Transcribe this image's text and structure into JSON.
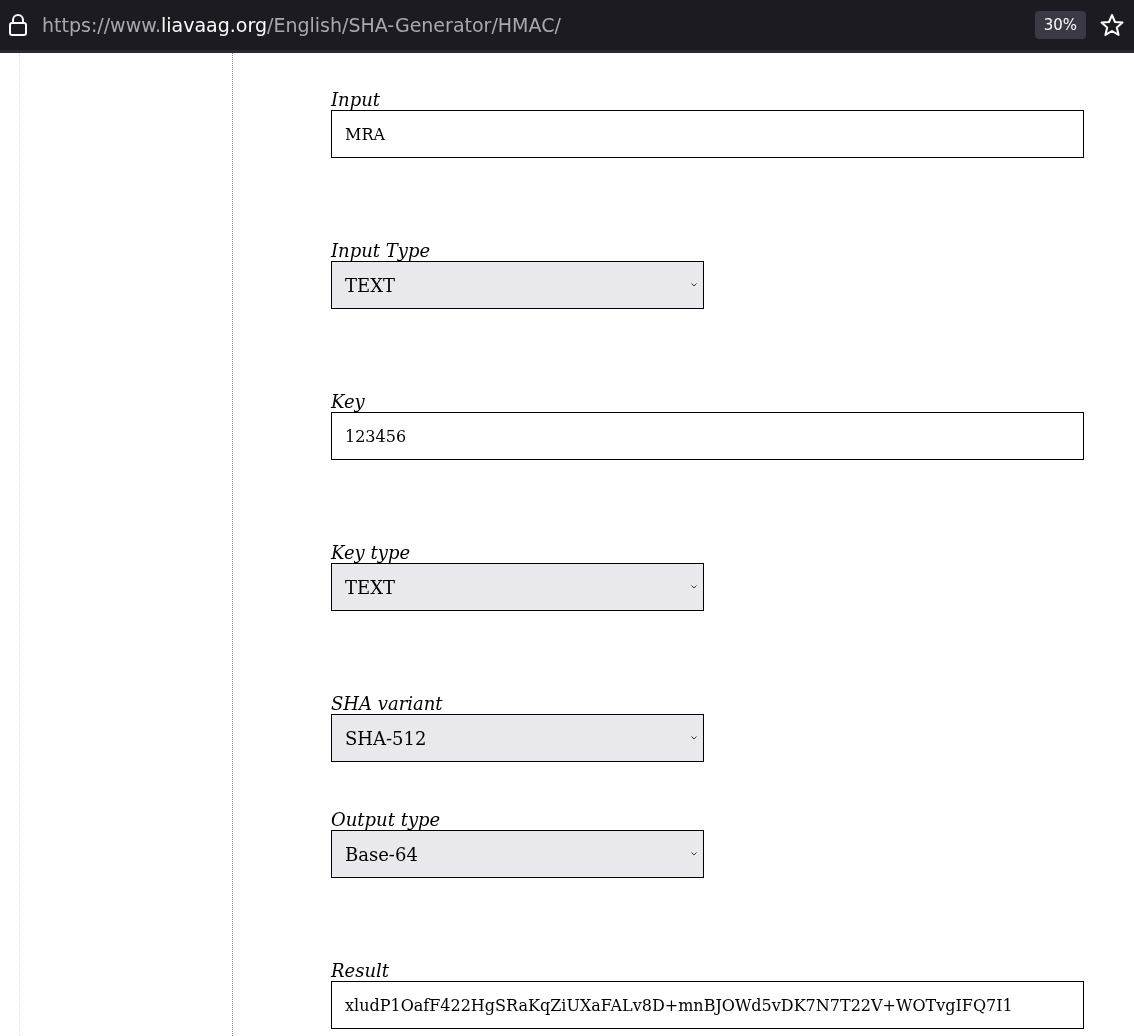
{
  "address_bar": {
    "url_prefix": "https://www.",
    "url_domain": "liavaag.org",
    "url_path": "/English/SHA-Generator/HMAC/",
    "zoom": "30%"
  },
  "form": [
    {
      "kind": "text",
      "label": "Input",
      "value": "MRA"
    },
    {
      "kind": "select",
      "label": "Input Type",
      "value": "TEXT"
    },
    {
      "kind": "text",
      "label": "Key",
      "value": "123456"
    },
    {
      "kind": "select",
      "label": "Key type",
      "value": "TEXT"
    },
    {
      "kind": "select",
      "label": "SHA variant",
      "value": "SHA-512"
    },
    {
      "kind": "select",
      "label": "Output type",
      "value": "Base-64"
    },
    {
      "kind": "text",
      "label": "Result",
      "value": "xludP1OafF422HgSRaKqZiUXaFALv8D+mnBJOWd5vDK7N7T22V+WOTvgIFQ7I1"
    }
  ]
}
